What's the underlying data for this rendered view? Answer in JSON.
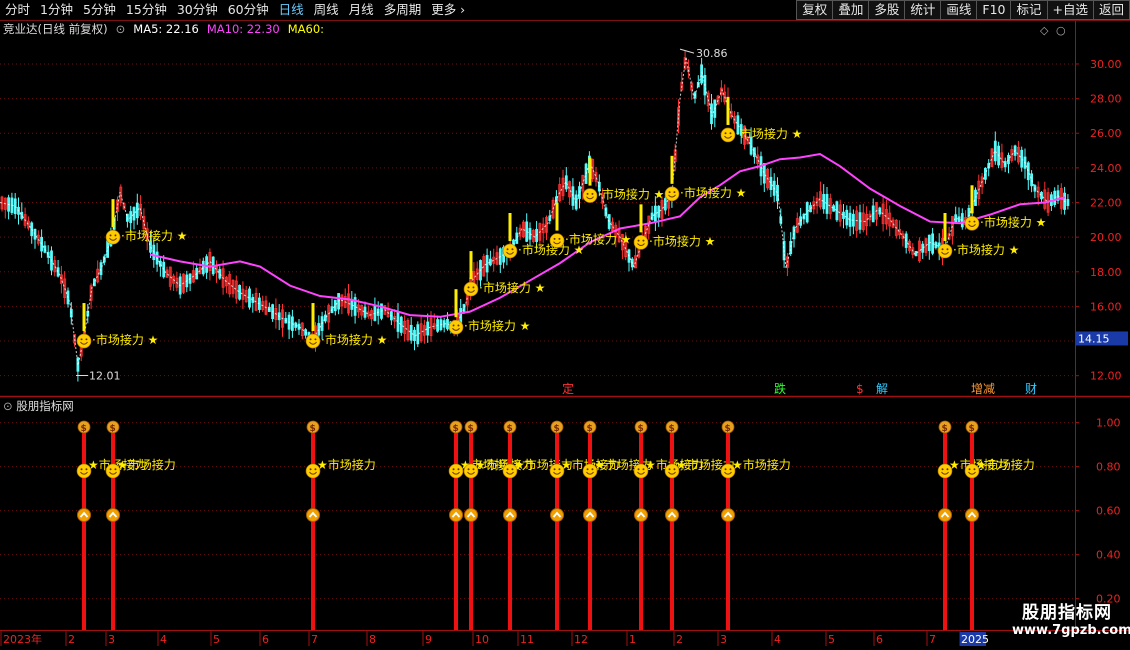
{
  "toolbar": {
    "periods": [
      "分时",
      "1分钟",
      "5分钟",
      "15分钟",
      "30分钟",
      "60分钟",
      "日线",
      "周线",
      "月线",
      "多周期",
      "更多"
    ],
    "active_period": "日线",
    "buttons": [
      "复权",
      "叠加",
      "多股",
      "统计",
      "画线",
      "F10",
      "标记",
      "+自选",
      "返回"
    ]
  },
  "legend": {
    "title": "竞业达(日线 前复权)",
    "ma5_label": "MA5: 22.16",
    "ma10_label": "MA10: 22.30",
    "ma60_label": "MA60:",
    "colors": {
      "ma5": "#ffffff",
      "ma10": "#ff44ff",
      "ma60": "#ffff00"
    }
  },
  "sub_panel": {
    "title": "股朋指标网"
  },
  "watermark": {
    "name": "股朋指标网",
    "url": "www.7gpzb.com"
  },
  "chart_data": {
    "type": "candlestick",
    "main": {
      "ylim": [
        11,
        31.5
      ],
      "yticks": [
        "12.00",
        "14.00",
        "16.00",
        "18.00",
        "20.00",
        "22.00",
        "24.00",
        "26.00",
        "28.00",
        "30.00"
      ],
      "current_price": "14.15",
      "high_label": "30.86",
      "low_label": "12.01",
      "ma_line_points": [
        [
          150,
          19.0
        ],
        [
          180,
          18.6
        ],
        [
          210,
          18.3
        ],
        [
          240,
          18.6
        ],
        [
          260,
          18.3
        ],
        [
          290,
          17.2
        ],
        [
          320,
          16.6
        ],
        [
          350,
          16.4
        ],
        [
          380,
          16.0
        ],
        [
          410,
          15.5
        ],
        [
          440,
          15.4
        ],
        [
          470,
          15.7
        ],
        [
          500,
          16.5
        ],
        [
          530,
          17.5
        ],
        [
          560,
          18.5
        ],
        [
          590,
          19.7
        ],
        [
          620,
          20.5
        ],
        [
          650,
          20.8
        ],
        [
          680,
          21.2
        ],
        [
          700,
          22.3
        ],
        [
          720,
          23.0
        ],
        [
          740,
          23.8
        ],
        [
          760,
          24.1
        ],
        [
          780,
          24.5
        ],
        [
          800,
          24.6
        ],
        [
          820,
          24.8
        ],
        [
          840,
          24.1
        ],
        [
          870,
          22.8
        ],
        [
          900,
          21.8
        ],
        [
          930,
          20.9
        ],
        [
          960,
          20.8
        ],
        [
          990,
          21.3
        ],
        [
          1020,
          21.9
        ],
        [
          1045,
          22.0
        ],
        [
          1065,
          22.3
        ]
      ],
      "price_path": [
        [
          0,
          22.0
        ],
        [
          15,
          21.8
        ],
        [
          30,
          20.6
        ],
        [
          45,
          19.3
        ],
        [
          60,
          17.8
        ],
        [
          70,
          16.2
        ],
        [
          78,
          12.6
        ],
        [
          84,
          14.2
        ],
        [
          92,
          17.1
        ],
        [
          102,
          18.3
        ],
        [
          112,
          20.1
        ],
        [
          120,
          22.6
        ],
        [
          128,
          21.0
        ],
        [
          140,
          21.7
        ],
        [
          150,
          19.5
        ],
        [
          165,
          18.0
        ],
        [
          180,
          17.2
        ],
        [
          195,
          17.8
        ],
        [
          210,
          18.6
        ],
        [
          225,
          17.5
        ],
        [
          240,
          16.8
        ],
        [
          255,
          16.3
        ],
        [
          270,
          15.8
        ],
        [
          285,
          15.2
        ],
        [
          300,
          14.8
        ],
        [
          313,
          14.1
        ],
        [
          325,
          15.3
        ],
        [
          340,
          16.4
        ],
        [
          355,
          16.0
        ],
        [
          370,
          15.5
        ],
        [
          385,
          15.8
        ],
        [
          400,
          15.0
        ],
        [
          415,
          14.3
        ],
        [
          430,
          14.8
        ],
        [
          445,
          15.0
        ],
        [
          456,
          14.9
        ],
        [
          465,
          16.0
        ],
        [
          472,
          17.5
        ],
        [
          485,
          18.4
        ],
        [
          498,
          18.8
        ],
        [
          510,
          19.2
        ],
        [
          522,
          20.5
        ],
        [
          535,
          20.0
        ],
        [
          548,
          20.8
        ],
        [
          558,
          22.4
        ],
        [
          566,
          23.2
        ],
        [
          576,
          22.0
        ],
        [
          590,
          24.3
        ],
        [
          598,
          23.2
        ],
        [
          608,
          21.0
        ],
        [
          620,
          20.0
        ],
        [
          634,
          18.3
        ],
        [
          642,
          19.7
        ],
        [
          652,
          21.2
        ],
        [
          662,
          21.6
        ],
        [
          672,
          22.5
        ],
        [
          680,
          28.0
        ],
        [
          686,
          30.4
        ],
        [
          694,
          28.0
        ],
        [
          702,
          29.5
        ],
        [
          712,
          27.0
        ],
        [
          722,
          28.5
        ],
        [
          732,
          27.0
        ],
        [
          740,
          26.3
        ],
        [
          752,
          25.2
        ],
        [
          765,
          23.6
        ],
        [
          778,
          22.5
        ],
        [
          786,
          18.2
        ],
        [
          795,
          20.5
        ],
        [
          808,
          21.5
        ],
        [
          820,
          22.2
        ],
        [
          835,
          21.6
        ],
        [
          850,
          21.0
        ],
        [
          865,
          20.9
        ],
        [
          878,
          21.6
        ],
        [
          890,
          21.0
        ],
        [
          905,
          19.9
        ],
        [
          915,
          19.0
        ],
        [
          930,
          19.7
        ],
        [
          945,
          19.3
        ],
        [
          955,
          21.1
        ],
        [
          967,
          20.9
        ],
        [
          975,
          22.2
        ],
        [
          985,
          23.6
        ],
        [
          995,
          25.0
        ],
        [
          1005,
          24.2
        ],
        [
          1015,
          25.0
        ],
        [
          1025,
          24.3
        ],
        [
          1035,
          22.8
        ],
        [
          1048,
          22.0
        ],
        [
          1058,
          22.4
        ],
        [
          1066,
          22.0
        ]
      ],
      "signals": [
        {
          "x": 84,
          "y": 14.0,
          "label": "市场接力"
        },
        {
          "x": 113,
          "y": 20.0,
          "label": "市场接力"
        },
        {
          "x": 313,
          "y": 14.0,
          "label": "市场接力"
        },
        {
          "x": 456,
          "y": 14.8,
          "label": "市场接力"
        },
        {
          "x": 471,
          "y": 17.0,
          "label": "市场接力"
        },
        {
          "x": 510,
          "y": 19.2,
          "label": "市场接力"
        },
        {
          "x": 557,
          "y": 19.8,
          "label": "市场接力"
        },
        {
          "x": 590,
          "y": 22.4,
          "label": "市场接力"
        },
        {
          "x": 641,
          "y": 19.7,
          "label": "市场接力"
        },
        {
          "x": 672,
          "y": 22.5,
          "label": "市场接力"
        },
        {
          "x": 728,
          "y": 25.9,
          "label": "市场接力"
        },
        {
          "x": 945,
          "y": 19.2,
          "label": "市场接力"
        },
        {
          "x": 972,
          "y": 20.8,
          "label": "市场接力"
        }
      ],
      "event_tags": [
        {
          "x": 568,
          "label": "定",
          "color": "#ff3333"
        },
        {
          "x": 780,
          "label": "跌",
          "color": "#33ff33"
        },
        {
          "x": 862,
          "label": "$",
          "color": "#ff3333"
        },
        {
          "x": 882,
          "label": "解",
          "color": "#33ccff"
        },
        {
          "x": 977,
          "label": "增减",
          "color": "#ff9933"
        },
        {
          "x": 1031,
          "label": "财",
          "color": "#33ccff"
        }
      ]
    },
    "sub": {
      "ylim": [
        0.08,
        1.08
      ],
      "yticks": [
        "0.20",
        "0.40",
        "0.60",
        "0.80",
        "1.00"
      ],
      "signal_x": [
        84,
        113,
        313,
        456,
        471,
        510,
        557,
        590,
        641,
        672,
        728,
        945,
        972
      ],
      "signal_label": "市场接力"
    },
    "x_axis": {
      "labels": [
        {
          "x": 1,
          "label": "2023年"
        },
        {
          "x": 66,
          "label": "2"
        },
        {
          "x": 106,
          "label": "3"
        },
        {
          "x": 158,
          "label": "4"
        },
        {
          "x": 211,
          "label": "5"
        },
        {
          "x": 260,
          "label": "6"
        },
        {
          "x": 309,
          "label": "7"
        },
        {
          "x": 367,
          "label": "8"
        },
        {
          "x": 423,
          "label": "9"
        },
        {
          "x": 473,
          "label": "10"
        },
        {
          "x": 518,
          "label": "11"
        },
        {
          "x": 572,
          "label": "12"
        },
        {
          "x": 627,
          "label": "1"
        },
        {
          "x": 674,
          "label": "2"
        },
        {
          "x": 718,
          "label": "3"
        },
        {
          "x": 772,
          "label": "4"
        },
        {
          "x": 826,
          "label": "5"
        },
        {
          "x": 874,
          "label": "6"
        },
        {
          "x": 927,
          "label": "7"
        },
        {
          "x": 960,
          "label": "2025"
        }
      ]
    }
  }
}
